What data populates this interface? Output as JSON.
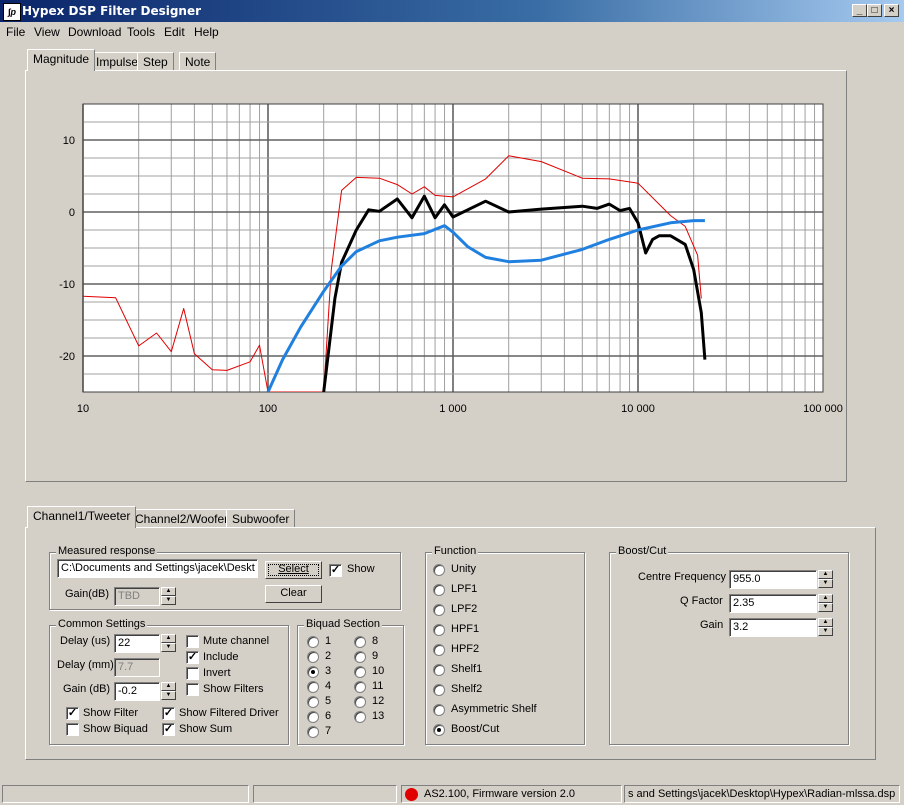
{
  "window": {
    "title": "Hypex DSP Filter Designer",
    "icon": "dsp-logo-icon",
    "minimize": "_",
    "maximize": "□",
    "close": "×"
  },
  "menu": [
    "File",
    "View",
    "Download",
    "Tools",
    "Edit",
    "Help"
  ],
  "top_tabs": [
    "Magnitude",
    "Impulse",
    "Step",
    "Note"
  ],
  "chart_data": {
    "type": "line",
    "x_scale": "log",
    "xlim": [
      10,
      100000
    ],
    "ylim": [
      -25,
      15
    ],
    "x_ticks": [
      10,
      100,
      1000,
      10000,
      100000
    ],
    "x_tick_labels": [
      "10",
      "100",
      "1 000",
      "10 000",
      "100 000"
    ],
    "y_ticks": [
      10,
      0,
      -10,
      -20
    ],
    "y_tick_labels": [
      "10",
      "0",
      "-10",
      "-20"
    ],
    "grid": true,
    "series": [
      {
        "color": "#e00000",
        "x": [
          10,
          15,
          20,
          25,
          30,
          35,
          40,
          50,
          60,
          80,
          90,
          100,
          120,
          150,
          200,
          220,
          250,
          300,
          400,
          500,
          600,
          700,
          800,
          1000,
          1500,
          2000,
          3000,
          5000,
          7000,
          10000,
          15000,
          18000,
          21000,
          22000
        ],
        "y": [
          -11.7,
          -11.9,
          -18.6,
          -16.8,
          -19.4,
          -13.4,
          -19.7,
          -21.9,
          -22,
          -20.8,
          -18.5,
          -25,
          -25,
          -25,
          -25,
          -8,
          3,
          4.8,
          4.7,
          3.8,
          2.5,
          3.5,
          2.3,
          2.1,
          4.6,
          7.8,
          7,
          4.7,
          4.6,
          4,
          -0.5,
          -2,
          -6,
          -12
        ]
      },
      {
        "color": "#000000",
        "x": [
          200,
          230,
          250,
          300,
          350,
          400,
          500,
          600,
          700,
          800,
          900,
          1000,
          1500,
          2000,
          3000,
          5000,
          6000,
          7000,
          8000,
          9000,
          10000,
          11000,
          12000,
          13000,
          15000,
          18000,
          20000,
          22000,
          23000
        ],
        "y": [
          -25,
          -12,
          -7,
          -2.5,
          0.3,
          0.1,
          1.8,
          -0.8,
          2.2,
          -0.8,
          1,
          -0.7,
          1.5,
          0,
          0.4,
          0.8,
          0.5,
          1.1,
          0.2,
          0.5,
          -1.5,
          -5.7,
          -3.8,
          -3.3,
          -3.3,
          -4.5,
          -8,
          -14,
          -20.5
        ]
      },
      {
        "color": "#2080e0",
        "x": [
          100,
          120,
          150,
          200,
          250,
          300,
          400,
          500,
          700,
          900,
          1000,
          1200,
          1500,
          2000,
          3000,
          5000,
          7000,
          10000,
          15000,
          20000,
          23000
        ],
        "y": [
          -25,
          -20.5,
          -16,
          -11,
          -7.5,
          -5.5,
          -4,
          -3.5,
          -3,
          -1.9,
          -2.8,
          -4.8,
          -6.3,
          -6.9,
          -6.7,
          -5.2,
          -3.8,
          -2.5,
          -1.5,
          -1.2,
          -1.2
        ]
      }
    ]
  },
  "channel_tabs": [
    "Channel1/Tweeter",
    "Channel2/Woofer",
    "Subwoofer"
  ],
  "measured": {
    "title": "Measured response",
    "path": "C:\\Documents and Settings\\jacek\\Deskt",
    "select_label": "Select",
    "show_label": "Show",
    "show_checked": true,
    "gain_label": "Gain(dB)",
    "gain_value": "TBD",
    "clear_label": "Clear"
  },
  "common": {
    "title": "Common Settings",
    "delay_us_label": "Delay (us)",
    "delay_us": "22",
    "delay_mm_label": "Delay (mm)",
    "delay_mm": "7.7",
    "gain_label": "Gain (dB)",
    "gain": "-0.2",
    "mute_label": "Mute channel",
    "include_label": "Include",
    "invert_label": "Invert",
    "show_filters_label": "Show Filters",
    "show_filter_label": "Show Filter",
    "show_filtered_driver_label": "Show Filtered Driver",
    "show_biquad_label": "Show Biquad",
    "show_sum_label": "Show Sum",
    "mute": false,
    "include": true,
    "invert": false,
    "show_filters": false,
    "show_filter": true,
    "show_filtered_driver": true,
    "show_biquad": false,
    "show_sum": true
  },
  "biquad": {
    "title": "Biquad Section",
    "left": [
      "1",
      "2",
      "3",
      "4",
      "5",
      "6",
      "7"
    ],
    "right": [
      "8",
      "9",
      "10",
      "11",
      "12",
      "13"
    ],
    "selected": "3"
  },
  "function": {
    "title": "Function",
    "options": [
      "Unity",
      "LPF1",
      "LPF2",
      "HPF1",
      "HPF2",
      "Shelf1",
      "Shelf2",
      "Asymmetric Shelf",
      "Boost/Cut"
    ],
    "selected": "Boost/Cut"
  },
  "boost": {
    "title": "Boost/Cut",
    "freq_label": "Centre Frequency",
    "freq": "955.0",
    "q_label": "Q Factor",
    "q": "2.35",
    "gain_label": "Gain",
    "gain": "3.2"
  },
  "statusbar": {
    "indicator_color": "#e00000",
    "device": "AS2.100, Firmware version 2.0",
    "file": "s and Settings\\jacek\\Desktop\\Hypex\\Radian-mlssa.dsp"
  }
}
